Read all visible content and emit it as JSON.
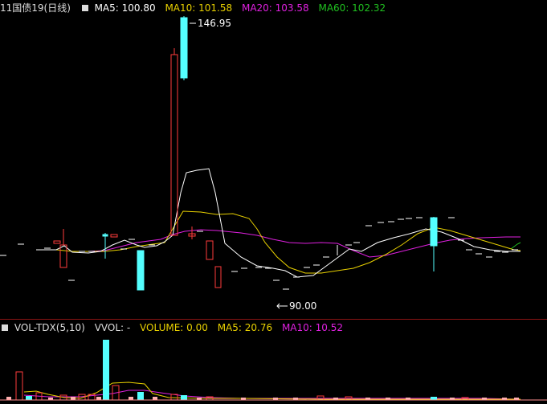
{
  "price_header": {
    "symbol": "11国债19",
    "period": "(日线)",
    "ma5": "MA5: 100.80",
    "ma10": "MA10: 101.58",
    "ma20": "MA20: 103.58",
    "ma60": "MA60: 102.32"
  },
  "volume_header": {
    "indicator": "VOL-TDX(5,10)",
    "vvol": "VVOL: -",
    "volume": "VOLUME: 0.00",
    "ma5": "MA5: 20.76",
    "ma10": "MA10: 10.52"
  },
  "annotations": {
    "high": "146.95",
    "low": "90.00"
  },
  "colors": {
    "up": "#ff3b3b",
    "down": "#54ffff",
    "flat": "#ffffff",
    "ma5": "#ffffff",
    "ma10": "#e8d000",
    "ma20": "#e020e0",
    "ma60": "#20c020",
    "divider": "#8a1414"
  }
}
